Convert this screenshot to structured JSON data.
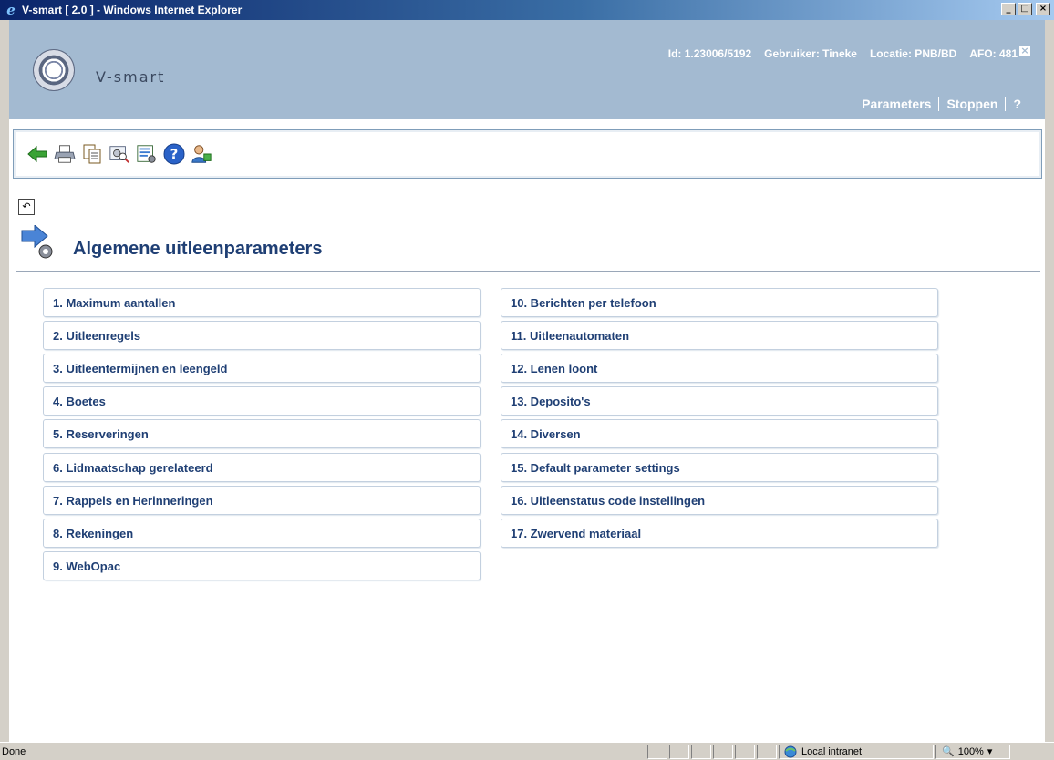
{
  "window": {
    "title": "V-smart [ 2.0 ] - Windows Internet Explorer",
    "controls": {
      "minimize": "_",
      "maximize": "□",
      "close": "×"
    }
  },
  "header": {
    "brand": "V-smart",
    "id": "Id: 1.23006/5192",
    "user": "Gebruiker: Tineke",
    "location": "Locatie: PNB/BD",
    "afo": "AFO: 481",
    "close": "×",
    "nav": {
      "parameters": "Parameters",
      "stop": "Stoppen",
      "help": "?"
    }
  },
  "toolbar": {
    "icons": [
      "back-arrow-icon",
      "print-icon",
      "copy-icon",
      "search-settings-icon",
      "list-settings-icon",
      "help-icon",
      "user-switch-icon"
    ]
  },
  "page": {
    "title": "Algemene uitleenparameters"
  },
  "menu": {
    "left": [
      "1. Maximum aantallen",
      "2. Uitleenregels",
      "3. Uitleentermijnen en leengeld",
      "4. Boetes",
      "5. Reserveringen",
      "6. Lidmaatschap gerelateerd",
      "7. Rappels en Herinneringen",
      "8. Rekeningen",
      "9. WebOpac"
    ],
    "right": [
      "10. Berichten per telefoon",
      "11. Uitleenautomaten",
      "12. Lenen loont",
      "13. Deposito's",
      "14. Diversen",
      "15. Default parameter settings",
      "16. Uitleenstatus code instellingen",
      "17. Zwervend materiaal"
    ]
  },
  "statusbar": {
    "status": "Done",
    "zone": "Local intranet",
    "zoom": "100%"
  },
  "colors": {
    "header_bg": "#a3bad1",
    "title_text": "#1f3f74",
    "menu_border": "#c3d0df"
  }
}
